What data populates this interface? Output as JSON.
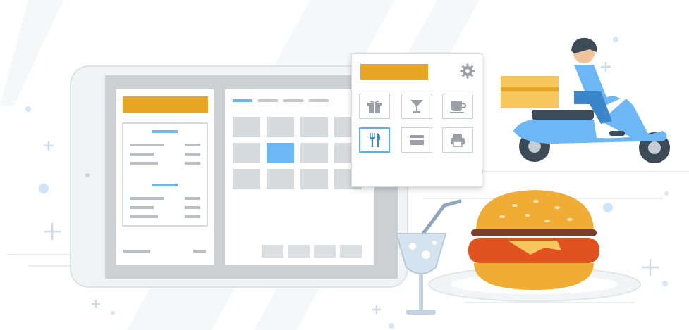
{
  "colors": {
    "accent": "#e7a623",
    "highlight": "#6db7f5",
    "device_frame": "#f1f2f3",
    "screen_bg": "#cdd0d3",
    "panel_gray": "#d5d8db",
    "icon_gray": "#9aa0a6",
    "courier_blue": "#6db7f5",
    "bun": "#f0ad35",
    "patty": "#e0521f",
    "cheese": "#f7c75e"
  },
  "tablet": {
    "receipt_lines_per_block": 3,
    "calendar_selected_cell": "row 2, column 2"
  },
  "popup": {
    "settings_icon": "gear-icon",
    "options": [
      {
        "icon": "gift-icon",
        "active": false
      },
      {
        "icon": "cocktail-icon",
        "active": false
      },
      {
        "icon": "coffee-cup-icon",
        "active": false
      },
      {
        "icon": "fork-knife-icon",
        "active": true
      },
      {
        "icon": "card-icon",
        "active": false
      },
      {
        "icon": "printer-icon",
        "active": false
      }
    ]
  },
  "illustration": {
    "items": [
      "delivery-scooter",
      "burger",
      "cocktail-glass"
    ]
  }
}
